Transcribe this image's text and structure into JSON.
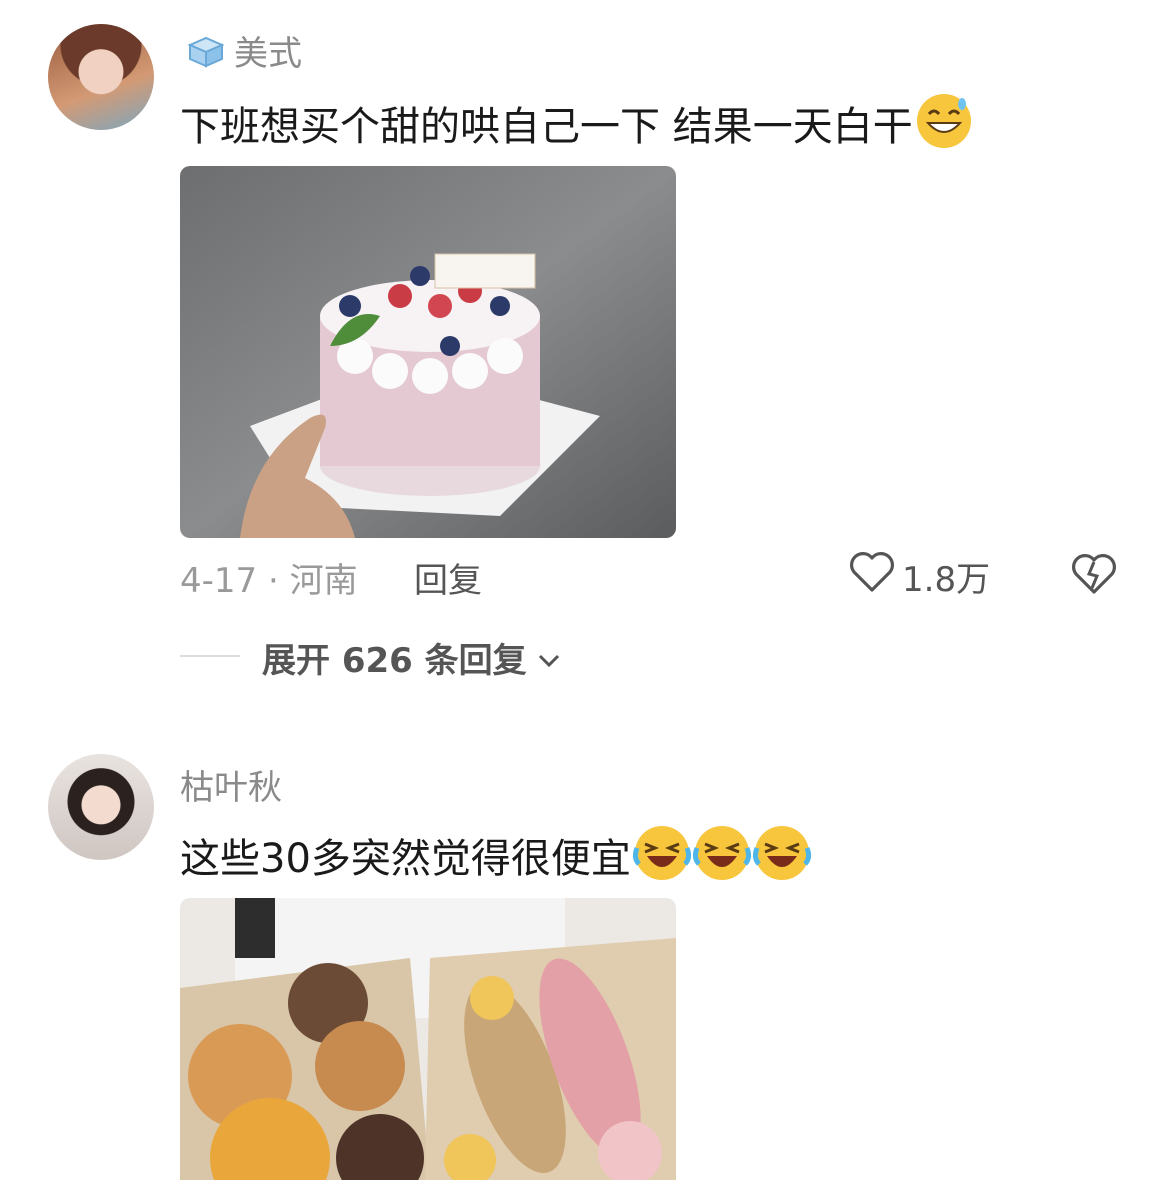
{
  "comments": [
    {
      "username": "美式",
      "badge_icon": "ice-cube-icon",
      "text": "下班想买个甜的哄自己一下  结果一天白干",
      "emoji": "grinning-sweat-emoji",
      "date_location": "4-17 · 河南",
      "reply_label": "回复",
      "likes": "1.8万",
      "expand_label": "展开 626 条回复"
    },
    {
      "username": "枯叶秋",
      "text": "这些30多突然觉得很便宜",
      "emoji": "rolling-laughing-emoji"
    }
  ],
  "colors": {
    "secondary_text": "#8a8a8a",
    "primary_text": "#1a1a1a",
    "emoji_yellow": "#f5c33b"
  }
}
